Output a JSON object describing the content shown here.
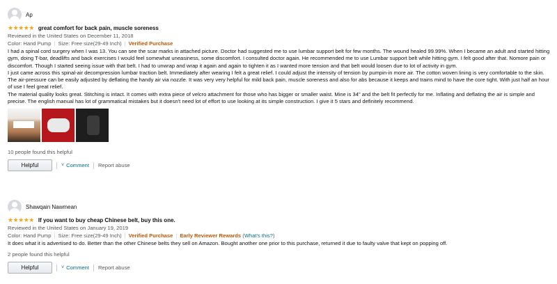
{
  "reviews": [
    {
      "author": "Ap",
      "stars": "★★★★★",
      "title": "great comfort for back pain, muscle soreness",
      "date_line": "Reviewed in the United States on December 11, 2018",
      "color_label": "Color: Hand Pump",
      "size_label": "Size: Free size(29-49 Inch)",
      "verified": "Verified Purchase",
      "paragraphs": [
        "I had a spinal cord surgery when I was 13. You can see the scar marks in attached picture. Doctor had suggested me to use lumbar support belt for few months. The wound healed 99.99%. When I became an adult and started hitting gym, doing T-bar, deadlifts and back exercises I would feel somewhat uneasiness, some discomfort. I consulted doctor again. He recommended me to use Lumbar support belt while hitting gym. I felt good after that. Nomore pain or discomfort. Though I started seeing issue with that belt. I had to unwrap and wrap it again and again to tighten it as I wanted more tension and that belt would loosen due to lot of activity in gym.",
        "I just came across this spinal-air decompression lumbar traction belt. Immediately after wearing I felt a great relief. I could adjust the intensity of tension by pumpin-in more air. The cotton woven lining is very comfortable to the skin. The air-pressure can be easily adjusted by deflating the handy air via nozzle. It was very very helpful for mild back pain, muscle soreness and also for abs because it keeps and trains mind to have the core tight. With just half an hour of use I feel great relief.",
        "The material quality looks great. Stitching is intact. It comes with extra piece of velcro attachment for those who has bigger or smaller waist. Mine is 34\" and the belt fit perfectly for me. Inflating and deflating the air is simple and precise. The english manual has lot of grammatical mistakes but it doesn't need lot of effort to use looking at its simple construction. I give it 5 stars and definitely recommend."
      ],
      "helpful_count": "10 people found this helpful",
      "helpful_btn": "Helpful",
      "comment": "Comment",
      "report": "Report abuse"
    },
    {
      "author": "Shawqain Nawmean",
      "stars": "★★★★★",
      "title": "If you want to buy cheap Chinese belt, buy this one.",
      "date_line": "Reviewed in the United States on January 19, 2019",
      "color_label": "Color: Hand Pump",
      "size_label": "Size: Free size(29-49 Inch)",
      "verified": "Verified Purchase",
      "early_reviewer": "Early Reviewer Rewards",
      "whats_this": "What's this?",
      "paragraphs": [
        "It does what it is advertised to do. Better than the other Chinese belts they sell on Amazon. Bought another one prior to this purchase, returned it due to faulty valve that kept on popping off."
      ],
      "helpful_count": "2 people found this helpful",
      "helpful_btn": "Helpful",
      "comment": "Comment",
      "report": "Report abuse"
    }
  ],
  "colors": {
    "star": "#f4a41c",
    "verified": "#c45500",
    "link": "#007185"
  },
  "icons": [
    "avatar-icon",
    "star-icon",
    "chevron-down-icon"
  ]
}
